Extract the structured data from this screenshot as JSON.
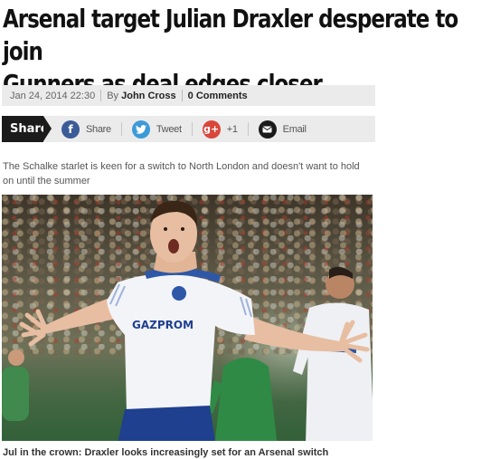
{
  "article": {
    "headline_line1": "Arsenal target Julian Draxler desperate to join",
    "headline_line2": "Gunners as deal edges closer",
    "date": "Jan 24, 2014 22:30",
    "by_prefix": "By",
    "author": "John Cross",
    "comments_count": "0",
    "comments_label": "Comments",
    "standfirst_line1": "The Schalke starlet is keen for a switch to North London and doesn't want to hold",
    "standfirst_line2": "on until the summer",
    "jersey_sponsor": "GAZPROM",
    "caption": "Jul in the crown: Draxler looks increasingly set for an Arsenal switch"
  },
  "share": {
    "label": "Share",
    "items": [
      {
        "label": "Share",
        "icon": "facebook-icon",
        "glyph": "f",
        "color": "#3b5b98"
      },
      {
        "label": "Tweet",
        "icon": "twitter-icon",
        "glyph": "t",
        "color": "#3d9ad8"
      },
      {
        "label": "+1",
        "icon": "google-plus-icon",
        "glyph": "g+",
        "color": "#d9473b"
      },
      {
        "label": "Email",
        "icon": "email-icon",
        "glyph": "✉",
        "color": "#1a1a1a"
      }
    ]
  }
}
